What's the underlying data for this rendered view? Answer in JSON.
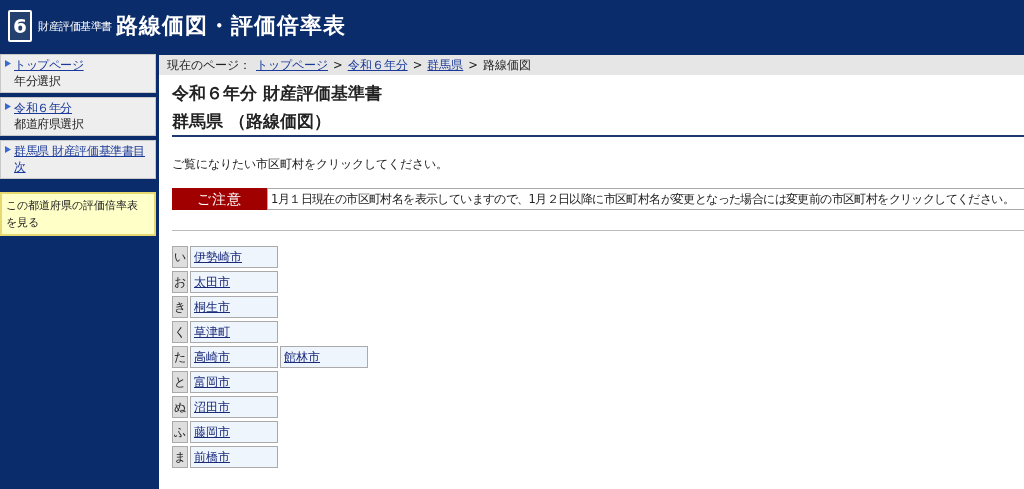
{
  "header": {
    "logo_number": "6",
    "subtitle": "財産評価基準書",
    "title": "路線価図・評価倍率表"
  },
  "sidebar": {
    "items": [
      {
        "link": "トップページ",
        "caption": "年分選択"
      },
      {
        "link": "令和６年分",
        "caption": "都道府県選択"
      },
      {
        "link": "群馬県 財産評価基準書目次"
      }
    ],
    "note": "この都道府県の評価倍率表を見る"
  },
  "breadcrumb": {
    "label": "現在のページ：",
    "separator": ">",
    "links": [
      "トップページ",
      "令和６年分",
      "群馬県"
    ],
    "current": "路線価図"
  },
  "heading": {
    "line1": "令和６年分 財産評価基準書",
    "line2": "群馬県 （路線価図）"
  },
  "instruction": "ご覧になりたい市区町村をクリックしてください。",
  "notice": {
    "label": "ご注意",
    "text": "1月１日現在の市区町村名を表示していますので、1月２日以降に市区町村名が変更となった場合には変更前の市区町村をクリックしてください。"
  },
  "index": [
    {
      "kana": "い",
      "cities": [
        "伊勢崎市"
      ]
    },
    {
      "kana": "お",
      "cities": [
        "太田市"
      ]
    },
    {
      "kana": "き",
      "cities": [
        "桐生市"
      ]
    },
    {
      "kana": "く",
      "cities": [
        "草津町"
      ]
    },
    {
      "kana": "た",
      "cities": [
        "高崎市",
        "館林市"
      ]
    },
    {
      "kana": "と",
      "cities": [
        "富岡市"
      ]
    },
    {
      "kana": "ぬ",
      "cities": [
        "沼田市"
      ]
    },
    {
      "kana": "ふ",
      "cities": [
        "藤岡市"
      ]
    },
    {
      "kana": "ま",
      "cities": [
        "前橋市"
      ]
    }
  ]
}
